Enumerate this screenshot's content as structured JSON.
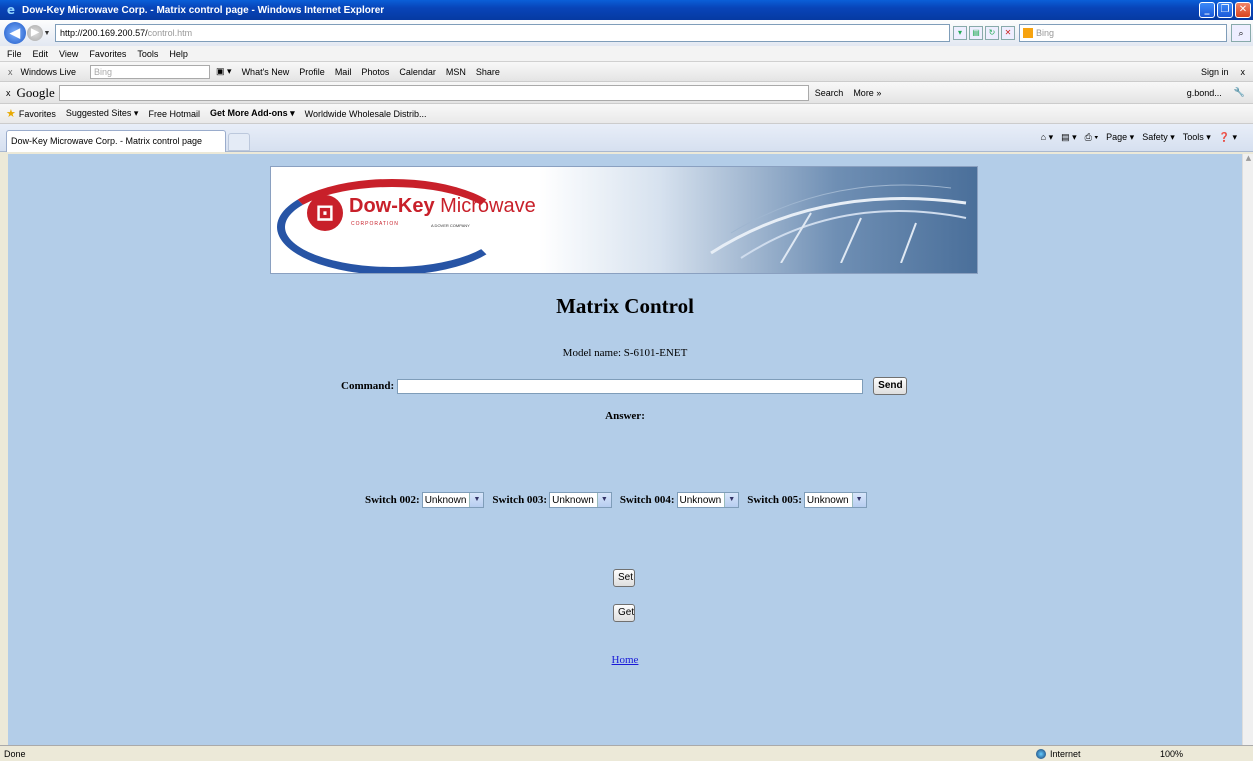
{
  "window": {
    "title": "Dow-Key Microwave Corp. - Matrix control page - Windows Internet Explorer",
    "minimize": "_",
    "maximize": "❐",
    "close": "✕"
  },
  "address_bar": {
    "url_host": "http://200.169.200.57/",
    "url_path": "control.htm",
    "search_placeholder": "Bing"
  },
  "menu": [
    "File",
    "Edit",
    "View",
    "Favorites",
    "Tools",
    "Help"
  ],
  "windows_live_bar": {
    "label": "Windows Live",
    "search_placeholder": "Bing",
    "items": [
      "What's New",
      "Profile",
      "Mail",
      "Photos",
      "Calendar",
      "MSN",
      "Share"
    ],
    "sign_in": "Sign in"
  },
  "google_bar": {
    "logo": "Google",
    "search_button": "Search",
    "more": "More »",
    "user": "g.bond..."
  },
  "favorites_bar": {
    "label": "Favorites",
    "items": [
      "Suggested Sites ▾",
      "Free Hotmail",
      "Get More Add-ons ▾",
      "Worldwide Wholesale Distrib..."
    ]
  },
  "tab": {
    "title": "Dow-Key Microwave Corp. - Matrix control page"
  },
  "command_bar": [
    "Page ▾",
    "Safety ▾",
    "Tools ▾"
  ],
  "page": {
    "banner": {
      "company": "Dow-Key",
      "company_suffix": "Microwave",
      "subtitle": "CORPORATION",
      "subtitle2": "A DOVER COMPANY",
      "badge": "CMP"
    },
    "heading": "Matrix Control",
    "model_label": "Model name: S-6101-ENET",
    "command_label": "Command:",
    "command_value": "",
    "send_label": "Send",
    "answer_label": "Answer:",
    "switches": [
      {
        "label": "Switch 002:",
        "value": "Unknown"
      },
      {
        "label": "Switch 003:",
        "value": "Unknown"
      },
      {
        "label": "Switch 004:",
        "value": "Unknown"
      },
      {
        "label": "Switch 005:",
        "value": "Unknown"
      }
    ],
    "set_label": "Set",
    "get_label": "Get",
    "home_link": "Home"
  },
  "status_bar": {
    "status": "Done",
    "zone": "Internet",
    "zoom": "100%"
  }
}
